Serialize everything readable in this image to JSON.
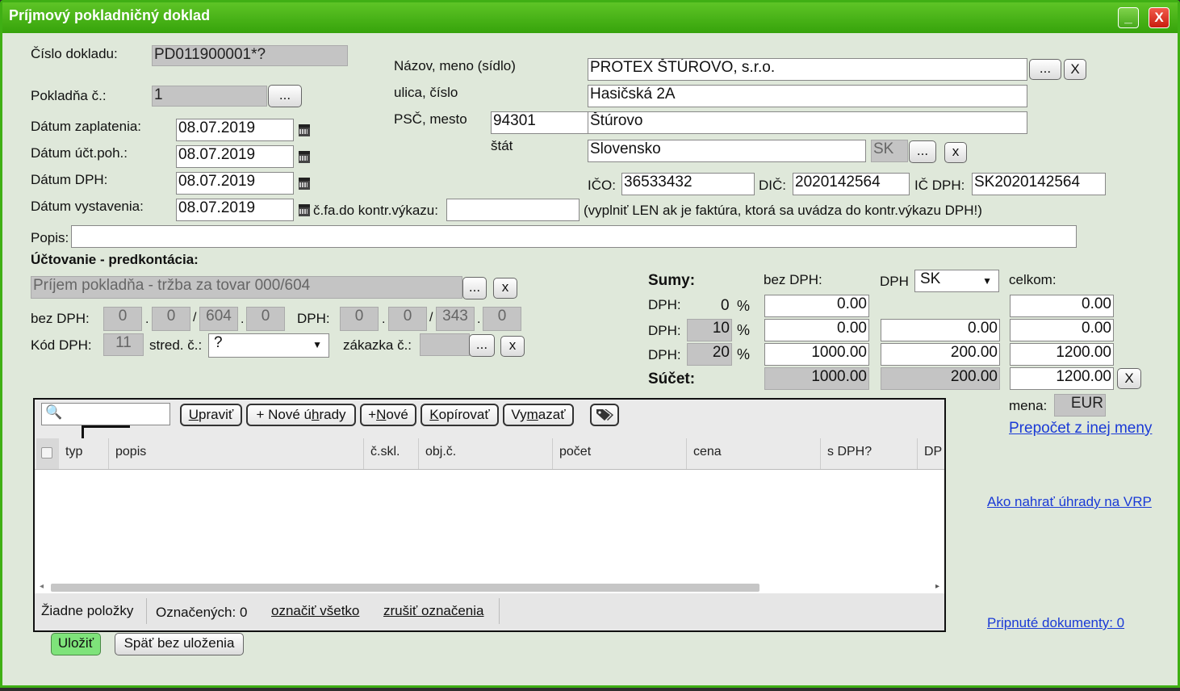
{
  "window": {
    "title": "Príjmový pokladničný doklad",
    "minimize_label": "_",
    "close_label": "X"
  },
  "document": {
    "number_label": "Číslo dokladu:",
    "number_value": "PD011900001*?",
    "register_label": "Pokladňa č.:",
    "register_value": "1",
    "register_picker": "...",
    "payment_date_label": "Dátum zaplatenia:",
    "payment_date": "08.07.2019",
    "accounting_date_label": "Dátum účt.poh.:",
    "accounting_date": "08.07.2019",
    "vat_date_label": "Dátum DPH:",
    "vat_date": "08.07.2019",
    "issue_date_label": "Dátum vystavenia:",
    "issue_date": "08.07.2019",
    "control_report_label": "č.fa.do kontr.výkazu:",
    "control_report_value": "",
    "control_report_note": "(vyplniť LEN ak je faktúra, ktorá sa uvádza do kontr.výkazu DPH!)",
    "description_label": "Popis:",
    "description_value": ""
  },
  "partner": {
    "name_label": "Názov, meno (sídlo)",
    "name_value": "PROTEX  ŠTÚROVO, s.r.o.",
    "street_label": "ulica, číslo",
    "street_value": "Hasičská 2A",
    "zip_city_label": "PSČ, mesto",
    "zip_value": "94301",
    "city_value": "Štúrovo",
    "country_label": "štát",
    "country_value": "Slovensko",
    "country_code": "SK",
    "ico_label": "IČO:",
    "ico_value": "36533432",
    "dic_label": "DIČ:",
    "dic_value": "2020142564",
    "icdph_label": "IČ DPH:",
    "icdph_value": "SK2020142564",
    "picker_label": "...",
    "clear_label": "X",
    "clear_small": "x"
  },
  "accounting": {
    "heading": "Účtovanie - predkontácia:",
    "template_value": "Príjem pokladňa - tržba za tovar 000/604",
    "picker_label": "...",
    "clear_label": "x",
    "net_label": "bez DPH:",
    "net_parts": [
      "0",
      "0",
      "604",
      "0"
    ],
    "vat_label": "DPH:",
    "vat_parts": [
      "0",
      "0",
      "343",
      "0"
    ],
    "dot": ".",
    "slash": "/",
    "vat_code_label": "Kód DPH:",
    "vat_code_value": "11",
    "center_label": "stred. č.:",
    "center_value": "?",
    "order_label": "zákazka č.:",
    "order_value": ""
  },
  "sums": {
    "heading": "Sumy:",
    "net_header": "bez DPH:",
    "vat_header": "DPH",
    "vat_country": "SK",
    "total_header": "celkom:",
    "rows": [
      {
        "label": "DPH:",
        "rate": "0",
        "pct": "%",
        "net": "0.00",
        "vat": "",
        "total": "0.00"
      },
      {
        "label": "DPH:",
        "rate": "10",
        "pct": "%",
        "net": "0.00",
        "vat": "0.00",
        "total": "0.00"
      },
      {
        "label": "DPH:",
        "rate": "20",
        "pct": "%",
        "net": "1000.00",
        "vat": "200.00",
        "total": "1200.00"
      }
    ],
    "sum_label": "Súčet:",
    "sum_net": "1000.00",
    "sum_vat": "200.00",
    "sum_total": "1200.00",
    "clear_label": "X",
    "currency_label": "mena:",
    "currency_value": "EUR",
    "convert_link": "Prepočet z inej meny"
  },
  "links": {
    "vrp": "Ako nahrať úhrady na VRP",
    "attached": "Pripnuté dokumenty: 0"
  },
  "grid": {
    "toolbar": {
      "edit_pre": "",
      "edit_key": "U",
      "edit_post": "praviť",
      "new_payments_pre": "+ Nové ú",
      "new_payments_key": "h",
      "new_payments_post": "rady",
      "new_pre": "+",
      "new_key": "N",
      "new_post": "ové",
      "copy_pre": "",
      "copy_key": "K",
      "copy_post": "opírovať",
      "delete_pre": "Vy",
      "delete_key": "m",
      "delete_post": "azať"
    },
    "columns": [
      "typ",
      "popis",
      "č.skl.",
      "obj.č.",
      "počet",
      "cena",
      "s DPH?",
      "DP"
    ],
    "footer": {
      "no_items": "Žiadne položky",
      "selected": "Označených: 0",
      "select_all": "označiť všetko",
      "unselect": "zrušiť označenia"
    }
  },
  "actions": {
    "save": "Uložiť",
    "back": "Späť bez uloženia"
  },
  "colors": {
    "title_bar": "#3faf14",
    "window_bg": "#dfe8da",
    "link": "#1a3ad6",
    "save_button": "#7ee37a"
  }
}
